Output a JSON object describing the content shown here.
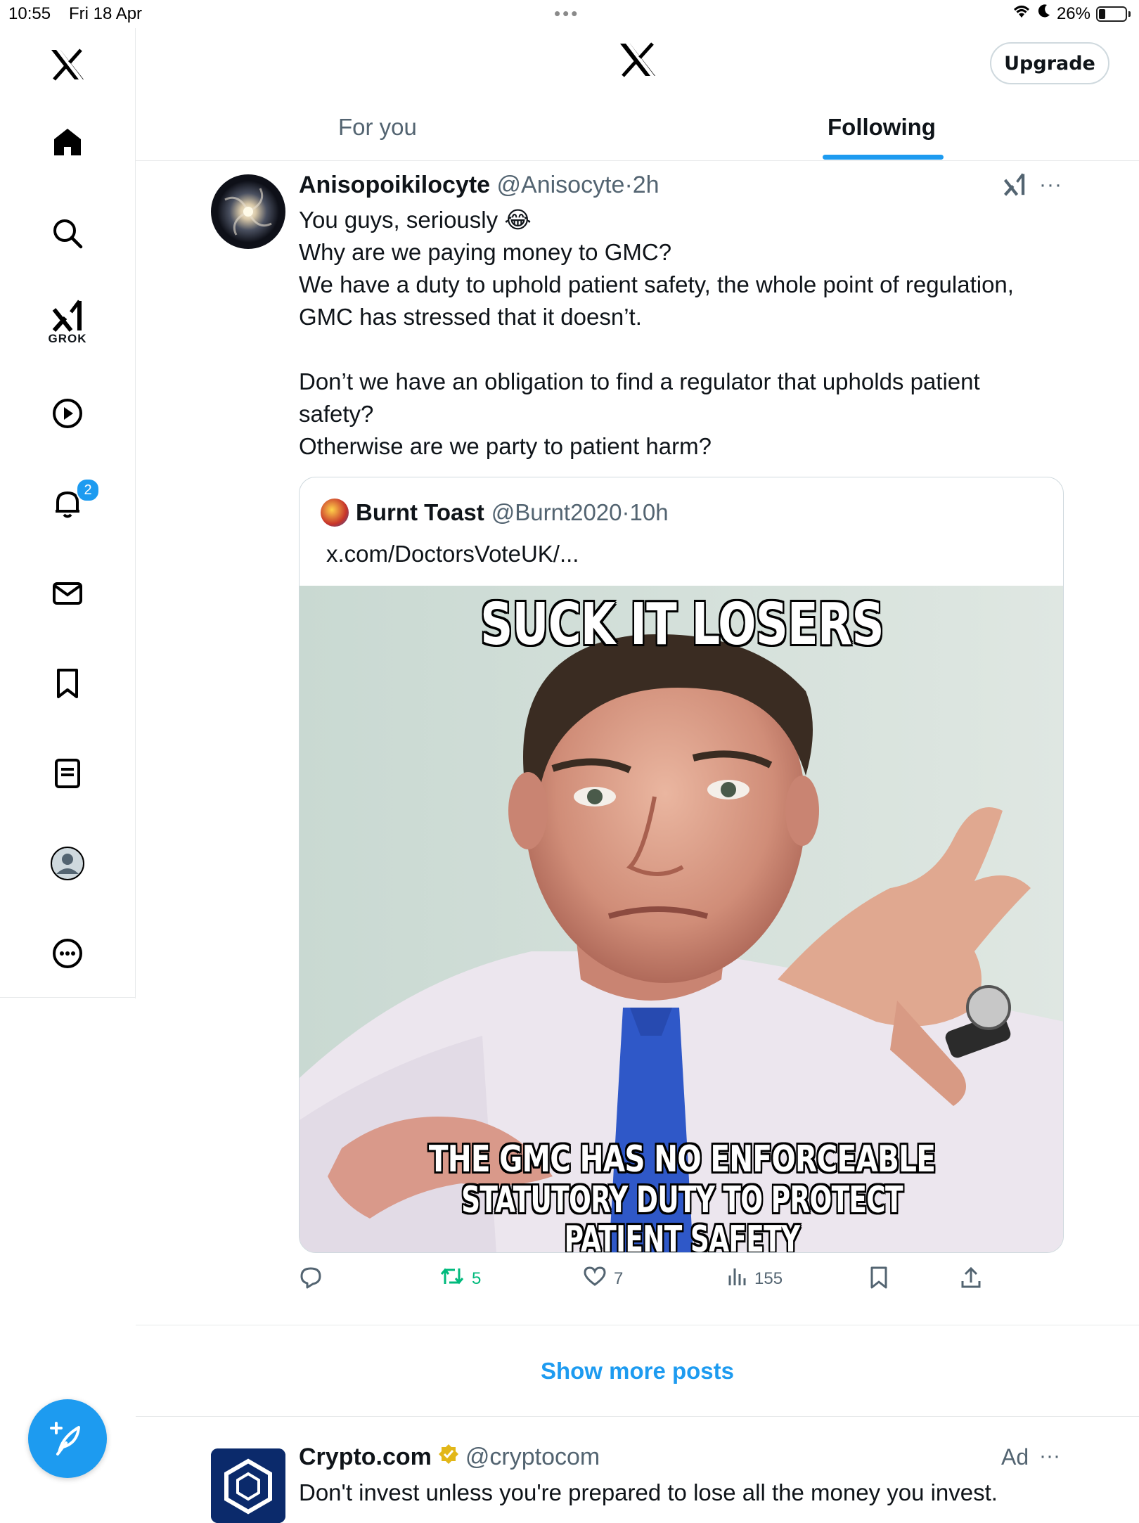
{
  "status_bar": {
    "time": "10:55",
    "date": "Fri 18 Apr",
    "battery": "26%",
    "battery_level": 0.26,
    "multitask_dots": "•••"
  },
  "sidebar": {
    "items": [
      {
        "name": "home"
      },
      {
        "name": "explore"
      },
      {
        "name": "grok",
        "label": "GROK"
      },
      {
        "name": "videos"
      },
      {
        "name": "notifications",
        "badge": "2"
      },
      {
        "name": "messages"
      },
      {
        "name": "bookmarks"
      },
      {
        "name": "lists"
      },
      {
        "name": "profile"
      },
      {
        "name": "more"
      }
    ]
  },
  "header": {
    "upgrade_label": "Upgrade"
  },
  "tabs": [
    {
      "label": "For you",
      "active": false
    },
    {
      "label": "Following",
      "active": true
    }
  ],
  "tweet": {
    "name": "Anisopoikilocyte",
    "handle": "@Anisocyte",
    "sep": "·",
    "time": "2h",
    "more": "···",
    "lines": [
      "You guys, seriously 😂",
      "Why are we paying money to GMC?",
      "We have a duty to uphold patient safety, the whole point of regulation,",
      "GMC has stressed that it doesn’t.",
      "",
      "Don’t we have an obligation to find a regulator that upholds patient",
      "safety?",
      "Otherwise are we party to patient harm?"
    ],
    "quote": {
      "name": "Burnt Toast",
      "handle": "@Burnt2020",
      "sep": "·",
      "time": "10h",
      "link": "x.com/DoctorsVoteUK/...",
      "meme_top": "SUCK IT LOSERS",
      "meme_bottom_1": "THE GMC HAS NO ENFORCEABLE",
      "meme_bottom_2": "STATUTORY DUTY TO PROTECT PATIENT SAFETY"
    },
    "actions": {
      "reposts": "5",
      "likes": "7",
      "views": "155"
    }
  },
  "show_more": "Show more posts",
  "ad": {
    "name": "Crypto.com",
    "handle": "@cryptocom",
    "label": "Ad",
    "more": "···",
    "text": "Don't invest unless you're prepared to lose all the money you invest."
  },
  "colors": {
    "accent": "#1d9bf0",
    "repost_green": "#00ba7c",
    "secondary_text": "#536471",
    "border": "#e7e9ea"
  }
}
